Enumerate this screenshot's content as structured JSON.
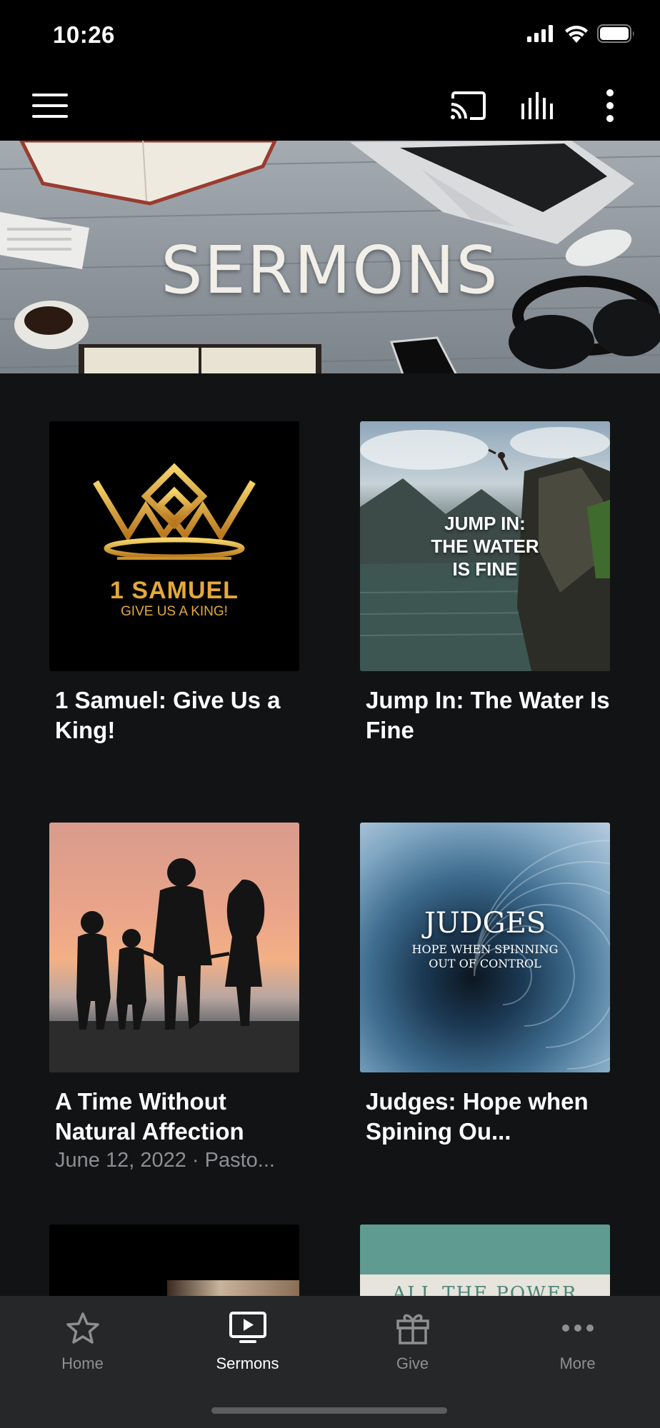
{
  "status_bar": {
    "time": "10:26"
  },
  "app_bar": {
    "menu_icon": "hamburger-menu-icon",
    "cast_icon": "cast-icon",
    "audio_icon": "audio-bars-icon",
    "more_icon": "more-vertical-icon"
  },
  "hero": {
    "title": "SERMONS"
  },
  "series": [
    {
      "title": "1 Samuel: Give Us a King!",
      "art_title": "1 SAMUEL",
      "art_subtitle": "GIVE US A KING!"
    },
    {
      "title": "Jump In: The Water Is Fine",
      "art_lines": [
        "JUMP IN:",
        "THE WATER",
        "IS FINE"
      ]
    },
    {
      "title": "A Time Without Natural Affection",
      "subtitle": "June 12, 2022 · Pasto..."
    },
    {
      "title": "Judges: Hope when Spining Ou...",
      "art_title": "JUDGES",
      "art_lines": [
        "HOPE WHEN SPINNING",
        "OUT OF CONTROL"
      ]
    },
    {
      "title": ""
    },
    {
      "title": "",
      "art_title": "ALL THE POWER"
    }
  ],
  "tabs": [
    {
      "label": "Home",
      "icon": "star-icon",
      "active": false
    },
    {
      "label": "Sermons",
      "icon": "tv-play-icon",
      "active": true
    },
    {
      "label": "Give",
      "icon": "gift-icon",
      "active": false
    },
    {
      "label": "More",
      "icon": "more-horizontal-icon",
      "active": false
    }
  ],
  "colors": {
    "background": "#121314",
    "tab_bar": "#262728",
    "active": "#ffffff",
    "inactive": "#8e8f91",
    "gold": "#d9a43a"
  }
}
